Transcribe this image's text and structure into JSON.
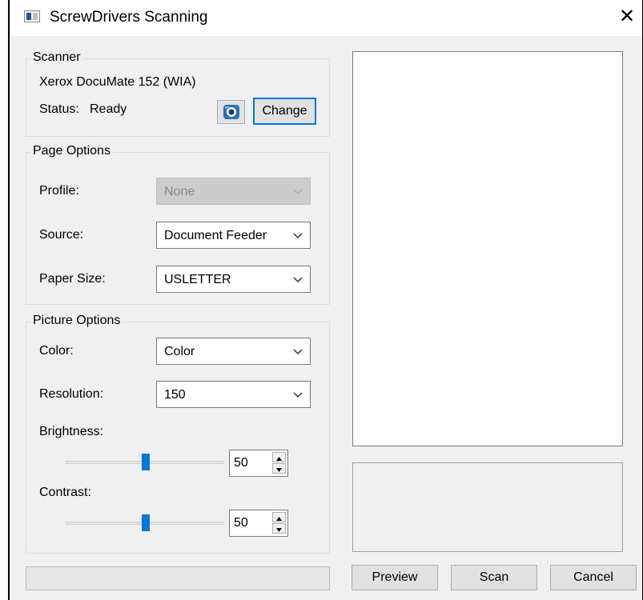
{
  "window": {
    "title": "ScrewDrivers Scanning",
    "close_glyph": "✕"
  },
  "scanner": {
    "group_label": "Scanner",
    "device_name": "Xerox DocuMate 152 (WIA)",
    "status_label": "Status:",
    "status_value": "Ready",
    "settings_icon": "scanner-settings-icon",
    "change_label": "Change"
  },
  "page_options": {
    "group_label": "Page Options",
    "profile": {
      "label": "Profile:",
      "value": "None",
      "enabled": false
    },
    "source": {
      "label": "Source:",
      "value": "Document Feeder"
    },
    "paper_size": {
      "label": "Paper Size:",
      "value": "USLETTER"
    }
  },
  "picture_options": {
    "group_label": "Picture Options",
    "color": {
      "label": "Color:",
      "value": "Color"
    },
    "resolution": {
      "label": "Resolution:",
      "value": "150"
    },
    "brightness": {
      "label": "Brightness:",
      "value": "50"
    },
    "contrast": {
      "label": "Contrast:",
      "value": "50"
    }
  },
  "buttons": {
    "preview": "Preview",
    "scan": "Scan",
    "cancel": "Cancel"
  },
  "colors": {
    "accent": "#0078d7",
    "window_bg": "#f0f0f0"
  }
}
